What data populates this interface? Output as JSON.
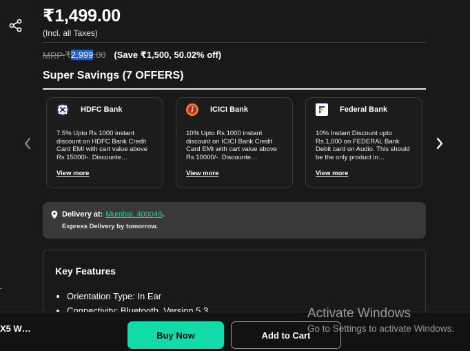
{
  "product": {
    "price": "₹1,499.00",
    "tax_note": "(Incl. all Taxes)",
    "mrp_label": "MRP: ",
    "mrp_currency": "₹",
    "mrp_highlight": "2,999",
    "mrp_tail": ".00",
    "savings": "(Save ₹1,500, 50.02% off)"
  },
  "super_savings": {
    "title": "Super Savings (7 OFFERS)",
    "offers": [
      {
        "bank": "HDFC Bank",
        "icon": "hdfc-logo-icon",
        "description": "7.5% Upto Rs 1000 instant discount on HDFC Bank Credit Card EMI with cart value above Rs 15000/-. Discounte…",
        "link": "View more"
      },
      {
        "bank": "ICICI Bank",
        "icon": "icici-logo-icon",
        "description": "10% Upto Rs 1000 instant discount on ICICI Bank Credit Card EMI with cart value above Rs 10000/-. Discounte…",
        "link": "View more"
      },
      {
        "bank": "Federal Bank",
        "icon": "federal-logo-icon",
        "description": "10% Instant Discount upto Rs.1,000 on FEDERAL Bank Debit card on Audio. This should be the only product in…",
        "link": "View more"
      }
    ]
  },
  "delivery": {
    "label": "Delivery at:",
    "location": "Mumbai, 400049",
    "suffix": ".",
    "note": "Express Delivery by tomorrow."
  },
  "key_features": {
    "title": "Key Features",
    "items": [
      "Orientation Type: In Ear",
      "Connectivity: Bluetooth, Version 5.3"
    ]
  },
  "bottom_bar": {
    "product_name": "X5 W…",
    "buy_now": "Buy Now",
    "add_to_cart": "Add to Cart"
  },
  "watermark": {
    "line1": "Activate Windows",
    "line2": "Go to Settings to activate Windows."
  },
  "colors": {
    "accent": "#12daa8",
    "background": "#191919",
    "highlight": "#1f5fbf"
  }
}
